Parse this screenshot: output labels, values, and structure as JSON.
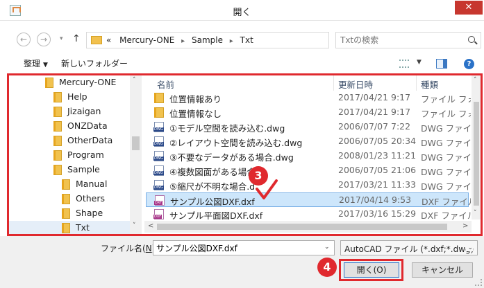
{
  "window": {
    "title": "開く",
    "close_glyph": "✕"
  },
  "address": {
    "back_glyph": "←",
    "forward_glyph": "→",
    "history_glyph": "▾",
    "up_glyph": "↑",
    "crumb_prefix": "«",
    "crumbs": [
      "Mercury-ONE",
      "Sample",
      "Txt"
    ],
    "crumb_sep": "▸",
    "dropdown_glyph": "⌄",
    "refresh_glyph": "↻",
    "search_placeholder": "Txtの検索"
  },
  "toolbar": {
    "organize_label": "整理",
    "organize_caret": "▼",
    "new_folder_label": "新しいフォルダー",
    "view_caret": "▼",
    "help_glyph": "?"
  },
  "tree": {
    "items": [
      {
        "label": "Mercury-ONE"
      },
      {
        "label": "Help"
      },
      {
        "label": "Jizaigan"
      },
      {
        "label": "ONZData"
      },
      {
        "label": "OtherData"
      },
      {
        "label": "Program"
      },
      {
        "label": "Sample"
      },
      {
        "label": "Manual"
      },
      {
        "label": "Others"
      },
      {
        "label": "Shape"
      },
      {
        "label": "Txt",
        "selected": true
      }
    ],
    "scroll_up": "˄",
    "scroll_down": "˅"
  },
  "list": {
    "columns": {
      "name": "名前",
      "modified": "更新日時",
      "type": "種類"
    },
    "sort_caret": "ˆ",
    "rows": [
      {
        "icon": "folder-icon",
        "name": "位置情報あり",
        "modified": "2017/04/21 9:17",
        "type": "ファイル フォルダー"
      },
      {
        "icon": "folder-icon",
        "name": "位置情報なし",
        "modified": "2017/04/21 9:17",
        "type": "ファイル フォルダー"
      },
      {
        "icon": "dwg-file-icon",
        "name": "①モデル空間を読み込む.dwg",
        "modified": "2006/07/07 7:22",
        "type": "DWG ファイル"
      },
      {
        "icon": "dwg-file-icon",
        "name": "②レイアウト空間を読み込む.dwg",
        "modified": "2006/07/05 20:34",
        "type": "DWG ファイル"
      },
      {
        "icon": "dwg-file-icon",
        "name": "③不要なデータがある場合.dwg",
        "modified": "2008/01/23 11:21",
        "type": "DWG ファイル"
      },
      {
        "icon": "dwg-file-icon",
        "name": "④複数図面がある場合",
        "modified": "2006/07/05 21:06",
        "type": "DWG ファイル"
      },
      {
        "icon": "dwg-file-icon",
        "name": "⑤縮尺が不明な場合.d",
        "modified": "2017/03/21 11:33",
        "type": "DWG ファイル"
      },
      {
        "icon": "dxf-file-icon",
        "name": "サンプル公図DXF.dxf",
        "modified": "2017/04/14 9:53",
        "type": "DXF ファイル",
        "selected": true
      },
      {
        "icon": "dxf-file-icon",
        "name": "サンプル平面図DXF.dxf",
        "modified": "2017/03/16 15:29",
        "type": "DXF ファイル"
      }
    ],
    "scroll_up": "˄",
    "scroll_down": "˅",
    "scroll_left": "<",
    "scroll_right": ">"
  },
  "annotations": {
    "step3": "3",
    "step4": "4",
    "check_color": "#e0292e",
    "badge_color": "#e0292e"
  },
  "footer": {
    "filename_label_pre": "ファイル名(",
    "filename_label_key": "N",
    "filename_label_post": "):",
    "filename_value": "サンプル公図DXF.dxf",
    "filename_caret": "⌄",
    "filter_value": "AutoCAD ファイル (*.dxf;*.dwg)",
    "filter_caret": "⌄",
    "open_label": "開く(O)",
    "cancel_label": "キャンセル"
  }
}
